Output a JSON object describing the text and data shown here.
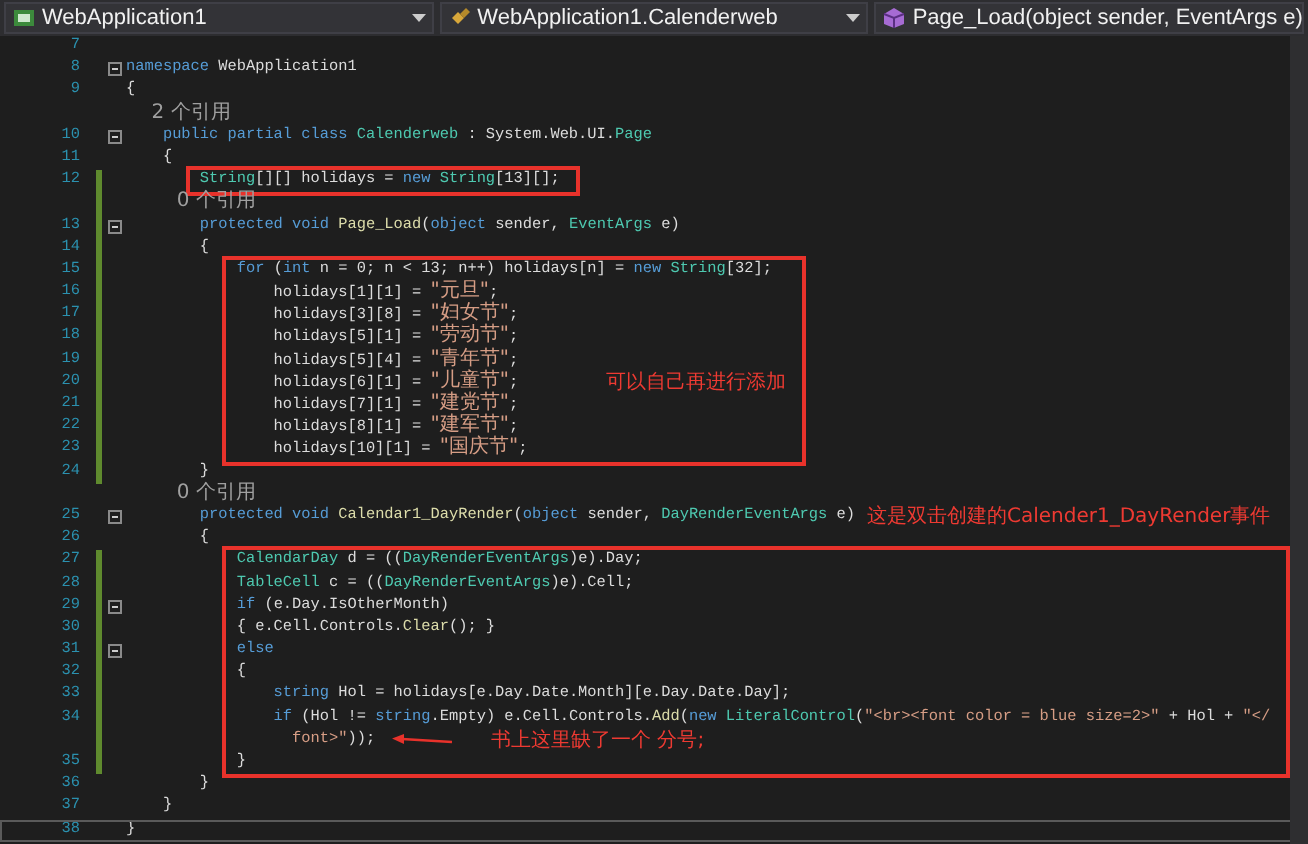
{
  "navigation_bar": [
    {
      "kind": "project",
      "label": "WebApplication1"
    },
    {
      "kind": "class",
      "label": "WebApplication1.Calenderweb"
    },
    {
      "kind": "method",
      "label": "Page_Load(object sender, EventArgs e)"
    }
  ],
  "lines": [
    {
      "number": "7",
      "changed": false,
      "fold": false,
      "boxed": false,
      "current": false
    },
    {
      "number": "8",
      "tokens": [
        {
          "kind": "kw",
          "text": "namespace"
        },
        {
          "kind": "id",
          "text": " WebApplication1"
        }
      ],
      "changed": false,
      "fold": true,
      "boxed": false,
      "current": false
    },
    {
      "number": "9",
      "tokens": [
        {
          "kind": "id",
          "text": "{"
        }
      ],
      "changed": false,
      "fold": false,
      "boxed": false,
      "current": false
    },
    {
      "tokens": [
        {
          "kind": "ref",
          "text": "    2 个引用"
        }
      ],
      "changed": false,
      "fold": false,
      "boxed": false,
      "current": false
    },
    {
      "number": "10",
      "tokens": [
        {
          "kind": "kw",
          "text": "    public partial class"
        },
        {
          "kind": "type",
          "text": " Calenderweb"
        },
        {
          "kind": "id",
          "text": " : System.Web.UI."
        },
        {
          "kind": "type",
          "text": "Page"
        }
      ],
      "changed": false,
      "fold": true,
      "boxed": false,
      "current": false
    },
    {
      "number": "11",
      "tokens": [
        {
          "kind": "id",
          "text": "    {"
        }
      ],
      "changed": false,
      "fold": false,
      "boxed": false,
      "current": false
    },
    {
      "number": "12",
      "tokens": [
        {
          "kind": "type",
          "text": "        String"
        },
        {
          "kind": "id",
          "text": "[][] holidays = "
        },
        {
          "kind": "kw",
          "text": "new"
        },
        {
          "kind": "type",
          "text": " String"
        },
        {
          "kind": "id",
          "text": "[13][];"
        }
      ],
      "changed": true,
      "fold": false,
      "boxed": true,
      "current": false
    },
    {
      "tokens": [
        {
          "kind": "ref",
          "text": "        0 个引用"
        }
      ],
      "changed": true,
      "fold": false,
      "boxed": false,
      "current": false
    },
    {
      "number": "13",
      "tokens": [
        {
          "kind": "kw",
          "text": "        protected void"
        },
        {
          "kind": "method",
          "text": " Page_Load"
        },
        {
          "kind": "id",
          "text": "("
        },
        {
          "kind": "kw",
          "text": "object"
        },
        {
          "kind": "id",
          "text": " sender, "
        },
        {
          "kind": "type",
          "text": "EventArgs"
        },
        {
          "kind": "id",
          "text": " e)"
        }
      ],
      "changed": true,
      "fold": true,
      "boxed": false,
      "current": false
    },
    {
      "number": "14",
      "tokens": [
        {
          "kind": "id",
          "text": "        {"
        }
      ],
      "changed": true,
      "fold": false,
      "boxed": false,
      "current": false
    },
    {
      "number": "15",
      "tokens": [
        {
          "kind": "kw",
          "text": "            for"
        },
        {
          "kind": "id",
          "text": " ("
        },
        {
          "kind": "kw",
          "text": "int"
        },
        {
          "kind": "id",
          "text": " n = 0; n < 13; n++) holidays[n] = "
        },
        {
          "kind": "kw",
          "text": "new"
        },
        {
          "kind": "type",
          "text": " String"
        },
        {
          "kind": "id",
          "text": "[32];"
        }
      ],
      "changed": true,
      "fold": false,
      "boxed": true,
      "current": false
    },
    {
      "number": "16",
      "tokens": [
        {
          "kind": "id",
          "text": "                holidays[1][1] = "
        },
        {
          "kind": "str",
          "text": "\"元旦\""
        },
        {
          "kind": "id",
          "text": ";"
        }
      ],
      "changed": true,
      "fold": false,
      "boxed": true,
      "current": false
    },
    {
      "number": "17",
      "tokens": [
        {
          "kind": "id",
          "text": "                holidays[3][8] = "
        },
        {
          "kind": "str",
          "text": "\"妇女节\""
        },
        {
          "kind": "id",
          "text": ";"
        }
      ],
      "changed": true,
      "fold": false,
      "boxed": true,
      "current": false
    },
    {
      "number": "18",
      "tokens": [
        {
          "kind": "id",
          "text": "                holidays[5][1] = "
        },
        {
          "kind": "str",
          "text": "\"劳动节\""
        },
        {
          "kind": "id",
          "text": ";"
        }
      ],
      "changed": true,
      "fold": false,
      "boxed": true,
      "current": false
    },
    {
      "number": "19",
      "tokens": [
        {
          "kind": "id",
          "text": "                holidays[5][4] = "
        },
        {
          "kind": "str",
          "text": "\"青年节\""
        },
        {
          "kind": "id",
          "text": ";"
        }
      ],
      "changed": true,
      "fold": false,
      "boxed": true,
      "current": false
    },
    {
      "number": "20",
      "tokens": [
        {
          "kind": "id",
          "text": "                holidays[6][1] = "
        },
        {
          "kind": "str",
          "text": "\"儿童节\""
        },
        {
          "kind": "id",
          "text": ";"
        }
      ],
      "note": {
        "kind": "aside",
        "text": "可以自己再进行添加"
      },
      "changed": true,
      "fold": false,
      "boxed": true,
      "current": false
    },
    {
      "number": "21",
      "tokens": [
        {
          "kind": "id",
          "text": "                holidays[7][1] = "
        },
        {
          "kind": "str",
          "text": "\"建党节\""
        },
        {
          "kind": "id",
          "text": ";"
        }
      ],
      "changed": true,
      "fold": false,
      "boxed": true,
      "current": false
    },
    {
      "number": "22",
      "tokens": [
        {
          "kind": "id",
          "text": "                holidays[8][1] = "
        },
        {
          "kind": "str",
          "text": "\"建军节\""
        },
        {
          "kind": "id",
          "text": ";"
        }
      ],
      "changed": true,
      "fold": false,
      "boxed": true,
      "current": false
    },
    {
      "number": "23",
      "tokens": [
        {
          "kind": "id",
          "text": "                holidays[10][1] = "
        },
        {
          "kind": "str",
          "text": "\"国庆节\""
        },
        {
          "kind": "id",
          "text": ";"
        }
      ],
      "changed": true,
      "fold": false,
      "boxed": true,
      "current": false
    },
    {
      "number": "24",
      "tokens": [
        {
          "kind": "id",
          "text": "        }"
        }
      ],
      "changed": true,
      "fold": false,
      "boxed": false,
      "current": false
    },
    {
      "tokens": [
        {
          "kind": "ref",
          "text": "        0 个引用"
        }
      ],
      "changed": false,
      "fold": false,
      "boxed": false,
      "current": false
    },
    {
      "number": "25",
      "tokens": [
        {
          "kind": "kw",
          "text": "        protected void"
        },
        {
          "kind": "method",
          "text": " Calendar1_DayRender"
        },
        {
          "kind": "id",
          "text": "("
        },
        {
          "kind": "kw",
          "text": "object"
        },
        {
          "kind": "id",
          "text": " sender, "
        },
        {
          "kind": "type",
          "text": "DayRenderEventArgs"
        },
        {
          "kind": "id",
          "text": " e)"
        }
      ],
      "note": {
        "kind": "inline",
        "text": "这是双击创建的Calender1_DayRender事件"
      },
      "changed": false,
      "fold": true,
      "boxed": false,
      "current": false
    },
    {
      "number": "26",
      "tokens": [
        {
          "kind": "id",
          "text": "        {"
        }
      ],
      "changed": false,
      "fold": false,
      "boxed": false,
      "current": false
    },
    {
      "number": "27",
      "tokens": [
        {
          "kind": "type",
          "text": "            CalendarDay"
        },
        {
          "kind": "id",
          "text": " d = (("
        },
        {
          "kind": "type",
          "text": "DayRenderEventArgs"
        },
        {
          "kind": "id",
          "text": ")e).Day;"
        }
      ],
      "changed": true,
      "fold": false,
      "boxed": true,
      "current": false
    },
    {
      "number": "28",
      "tokens": [
        {
          "kind": "type",
          "text": "            TableCell"
        },
        {
          "kind": "id",
          "text": " c = (("
        },
        {
          "kind": "type",
          "text": "DayRenderEventArgs"
        },
        {
          "kind": "id",
          "text": ")e).Cell;"
        }
      ],
      "changed": true,
      "fold": false,
      "boxed": true,
      "current": false
    },
    {
      "number": "29",
      "tokens": [
        {
          "kind": "kw",
          "text": "            if"
        },
        {
          "kind": "id",
          "text": " (e.Day.IsOtherMonth)"
        }
      ],
      "changed": true,
      "fold": true,
      "boxed": true,
      "current": false
    },
    {
      "number": "30",
      "tokens": [
        {
          "kind": "id",
          "text": "            { e.Cell.Controls."
        },
        {
          "kind": "method",
          "text": "Clear"
        },
        {
          "kind": "id",
          "text": "(); }"
        }
      ],
      "changed": true,
      "fold": false,
      "boxed": true,
      "current": false
    },
    {
      "number": "31",
      "tokens": [
        {
          "kind": "kw",
          "text": "            else"
        }
      ],
      "changed": true,
      "fold": true,
      "boxed": true,
      "current": false
    },
    {
      "number": "32",
      "tokens": [
        {
          "kind": "id",
          "text": "            {"
        }
      ],
      "changed": true,
      "fold": false,
      "boxed": true,
      "current": false
    },
    {
      "number": "33",
      "tokens": [
        {
          "kind": "kw",
          "text": "                string"
        },
        {
          "kind": "id",
          "text": " Hol = holidays[e.Day.Date.Month][e.Day.Date.Day];"
        }
      ],
      "changed": true,
      "fold": false,
      "boxed": true,
      "current": false
    },
    {
      "number": "34",
      "tokens": [
        {
          "kind": "kw",
          "text": "                if"
        },
        {
          "kind": "id",
          "text": " (Hol != "
        },
        {
          "kind": "kw",
          "text": "string"
        },
        {
          "kind": "id",
          "text": ".Empty) e.Cell.Controls."
        },
        {
          "kind": "method",
          "text": "Add"
        },
        {
          "kind": "id",
          "text": "("
        },
        {
          "kind": "kw",
          "text": "new"
        },
        {
          "kind": "type",
          "text": " LiteralControl"
        },
        {
          "kind": "id",
          "text": "("
        },
        {
          "kind": "str",
          "text": "\"<br><font color = blue size=2>\""
        },
        {
          "kind": "id",
          "text": " + Hol + "
        },
        {
          "kind": "str",
          "text": "\"</"
        }
      ],
      "changed": true,
      "fold": false,
      "boxed": true,
      "current": false
    },
    {
      "tokens": [
        {
          "kind": "str",
          "text": "                  font>\""
        },
        {
          "kind": "id",
          "text": "));"
        }
      ],
      "note": {
        "kind": "arrow",
        "text": "书上这里缺了一个 分号;"
      },
      "changed": true,
      "fold": false,
      "boxed": true,
      "current": false
    },
    {
      "number": "35",
      "tokens": [
        {
          "kind": "id",
          "text": "            }"
        }
      ],
      "changed": true,
      "fold": false,
      "boxed": true,
      "current": false
    },
    {
      "number": "36",
      "tokens": [
        {
          "kind": "id",
          "text": "        }"
        }
      ],
      "changed": false,
      "fold": false,
      "boxed": false,
      "current": false
    },
    {
      "number": "37",
      "tokens": [
        {
          "kind": "id",
          "text": "    }"
        }
      ],
      "changed": false,
      "fold": false,
      "boxed": false,
      "current": false
    },
    {
      "number": "38",
      "tokens": [
        {
          "kind": "id",
          "text": "}"
        }
      ],
      "changed": false,
      "fold": false,
      "boxed": false,
      "current": true
    }
  ]
}
